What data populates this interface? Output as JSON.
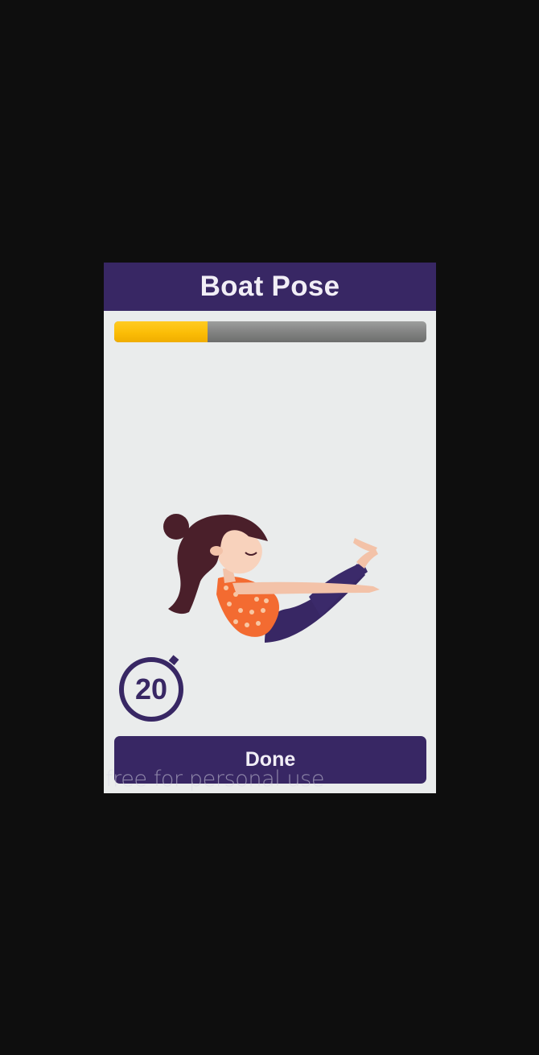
{
  "header": {
    "title": "Boat Pose"
  },
  "progress": {
    "fraction": 0.3
  },
  "illustration": {
    "icon": "boat-pose-illustration"
  },
  "timer": {
    "icon": "stopwatch-icon",
    "value": "20"
  },
  "actions": {
    "done_label": "Done"
  },
  "watermark": {
    "text": "free for personal use"
  },
  "colors": {
    "primary": "#382764",
    "accent": "#fbbd06",
    "track": "#858685",
    "background": "#eaecec",
    "outer": "#0e0e0e"
  }
}
